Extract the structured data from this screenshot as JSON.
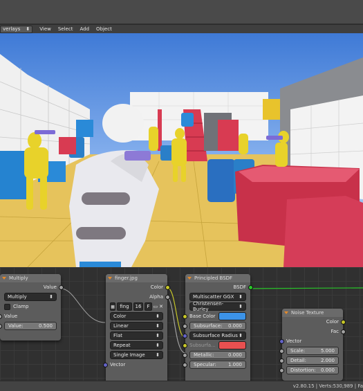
{
  "menu": {
    "overlays_label": "verlays",
    "items": [
      "View",
      "Select",
      "Add",
      "Object"
    ]
  },
  "nodes": {
    "multiply": {
      "title": "Multiply",
      "output": "Value",
      "operation": "Multiply",
      "clamp": "Clamp",
      "input": "Value",
      "value_label": "Value:",
      "value": "0.500"
    },
    "image": {
      "title": "finger.jpg",
      "out_color": "Color",
      "out_alpha": "Alpha",
      "image_name": "fing",
      "users": "16",
      "fake": "F",
      "color_space": "Color",
      "interpolation": "Linear",
      "projection": "Flat",
      "extension": "Repeat",
      "source": "Single Image",
      "vector": "Vector"
    },
    "bsdf": {
      "title": "Principled BSDF",
      "output": "BSDF",
      "distribution": "Multiscatter GGX",
      "subsurface_method": "Christensen-Burley",
      "base_color_label": "Base Color",
      "base_color": "#3c93e8",
      "subsurface_label": "Subsurface:",
      "subsurface": "0.000",
      "subsurface_radius": "Subsurface Radius",
      "subsurface_color_label": "Subsurfa...",
      "subsurface_color": "#e85050",
      "metallic_label": "Metallic:",
      "metallic": "0.000",
      "specular_label": "Specular:",
      "specular": "1.000"
    },
    "noise": {
      "title": "Noise Texture",
      "out_color": "Color",
      "out_fac": "Fac",
      "vector": "Vector",
      "scale_label": "Scale:",
      "scale": "5.000",
      "detail_label": "Detail:",
      "detail": "2.000",
      "distortion_label": "Distortion:",
      "distortion": "0.000"
    }
  },
  "status": {
    "text": "v2.80.15 | Verts:530,989 | Fa"
  }
}
